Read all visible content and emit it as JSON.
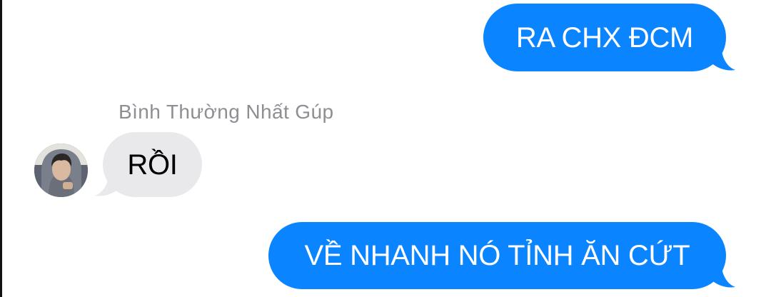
{
  "conversation": {
    "messages": [
      {
        "direction": "outgoing",
        "text": "RA CHX ĐCM"
      },
      {
        "direction": "incoming",
        "sender": "Bình Thường Nhất Gúp",
        "text": "RỒI"
      },
      {
        "direction": "outgoing",
        "text": "VỀ NHANH NÓ TỈNH ĂN CỨT"
      }
    ]
  },
  "colors": {
    "outgoing_bubble": "#0a84ff",
    "incoming_bubble": "#e9e9eb",
    "sender_name": "#8e8e93"
  }
}
